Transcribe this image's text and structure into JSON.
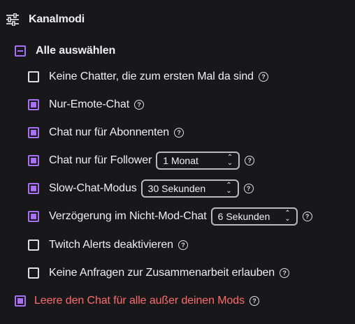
{
  "header": {
    "title": "Kanalmodi",
    "icon": "sliders-icon"
  },
  "select_all": {
    "label": "Alle auswählen",
    "state": "indeterminate"
  },
  "options": [
    {
      "label": "Keine Chatter, die zum ersten Mal da sind",
      "checked": false
    },
    {
      "label": "Nur-Emote-Chat",
      "checked": true
    },
    {
      "label": "Chat nur für Abonnenten",
      "checked": true
    },
    {
      "label": "Chat nur für Follower",
      "checked": true,
      "select": "1 Monat"
    },
    {
      "label": "Slow-Chat-Modus",
      "checked": true,
      "select": "30 Sekunden"
    },
    {
      "label": "Verzögerung im Nicht-Mod-Chat",
      "checked": true,
      "select": "6 Sekunden"
    },
    {
      "label": "Twitch Alerts deaktivieren",
      "checked": false
    },
    {
      "label": "Keine Anfragen zur Zusammenarbeit erlauben",
      "checked": false
    }
  ],
  "clear_chat": {
    "label": "Leere den Chat für alle außer deinen Mods",
    "checked": true
  },
  "help_glyph": "?",
  "colors": {
    "accent": "#a970ff",
    "danger": "#ff6b6b",
    "background": "#18181b",
    "text": "#efeff1"
  }
}
